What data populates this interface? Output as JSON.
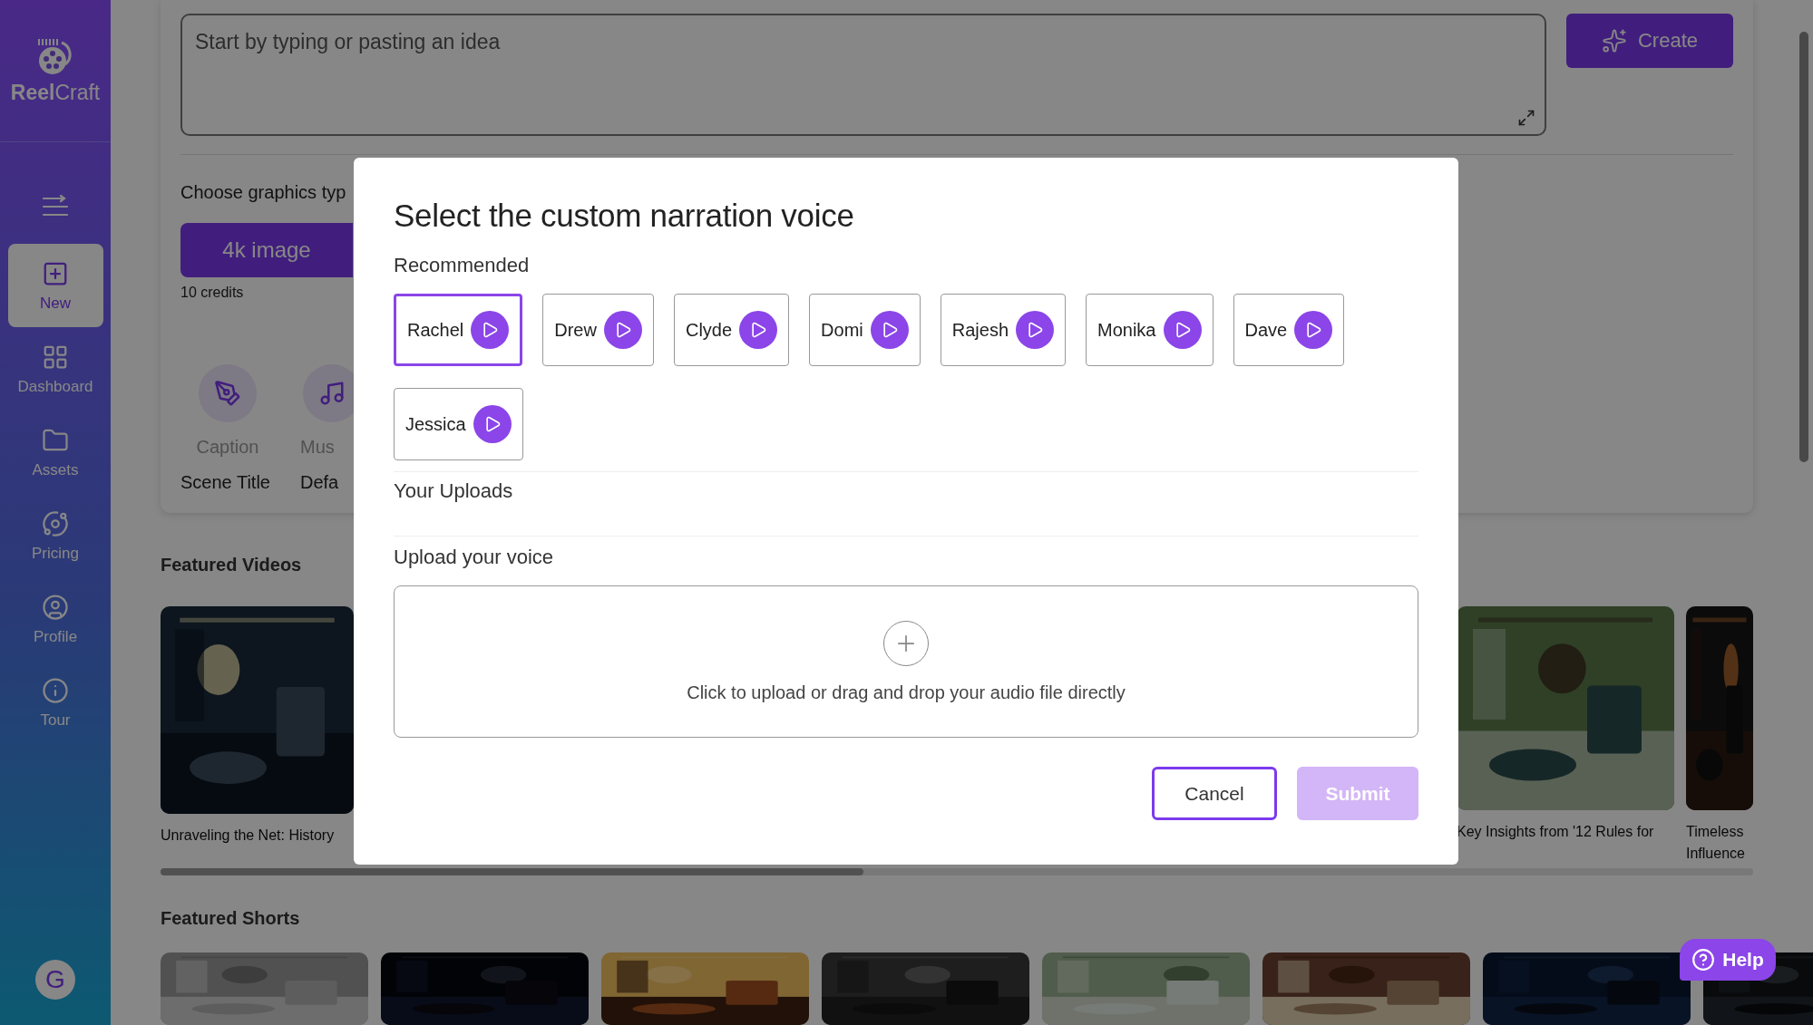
{
  "sidebar": {
    "logo": "**Reel**Craft",
    "items": [
      {
        "kind": "new",
        "label": "New",
        "selected": true
      },
      {
        "kind": "dashboard",
        "label": "Dashboard",
        "selected": false
      },
      {
        "kind": "assets",
        "label": "Assets",
        "selected": false
      },
      {
        "kind": "pricing",
        "label": "Pricing",
        "selected": false
      },
      {
        "kind": "profile",
        "label": "Profile",
        "selected": false
      },
      {
        "kind": "tour",
        "label": "Tour",
        "selected": false
      }
    ],
    "avatar": "G"
  },
  "editor": {
    "placeholder": "Start by typing or pasting an idea",
    "create_button": "Create",
    "graphics_label": "Choose graphics typ",
    "graphics_option": {
      "label": "4k image",
      "credits": "10 credits"
    },
    "tools": [
      {
        "kind": "pen",
        "label": "Caption",
        "value": "Scene Title"
      },
      {
        "kind": "music",
        "label": "Mus",
        "value": "Defa"
      }
    ]
  },
  "featured_videos": {
    "title": "Featured Videos",
    "items": [
      {
        "kind": "picture",
        "caption": "Unraveling the Net: History"
      },
      {
        "kind": "picture",
        "caption": "Key Insights from '12 Rules for"
      },
      {
        "kind": "picture",
        "caption": "Timeless Influence"
      }
    ]
  },
  "featured_shorts": {
    "title": "Featured Shorts"
  },
  "dialog": {
    "title": "Select the custom narration voice",
    "recommended_label": "Recommended",
    "voices": [
      {
        "name": "Rachel",
        "selected": true
      },
      {
        "name": "Drew",
        "selected": false
      },
      {
        "name": "Clyde",
        "selected": false
      },
      {
        "name": "Domi",
        "selected": false
      },
      {
        "name": "Rajesh",
        "selected": false
      },
      {
        "name": "Monika",
        "selected": false
      },
      {
        "name": "Dave",
        "selected": false
      },
      {
        "name": "Jessica",
        "selected": false
      }
    ],
    "uploads_label": "Your Uploads",
    "upload_label": "Upload your voice",
    "dropzone_text": "Click to upload or drag and drop your audio file directly",
    "cancel_button": "Cancel",
    "submit_button": {
      "label": "Submit",
      "disabled": true
    }
  },
  "help_button": "Help"
}
